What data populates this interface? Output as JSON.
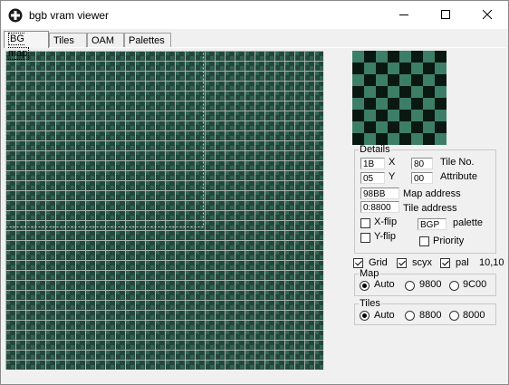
{
  "window": {
    "title": "bgb vram viewer"
  },
  "tabs": [
    {
      "label": "BG map",
      "active": true
    },
    {
      "label": "Tiles",
      "active": false
    },
    {
      "label": "OAM",
      "active": false
    },
    {
      "label": "Palettes",
      "active": false
    }
  ],
  "colors": {
    "tile_dark": "#24463c",
    "tile_light": "#3d7e68",
    "grid_line": "#a8b5ad",
    "selection": "#c8c8c8",
    "tile_black": "#0a1812"
  },
  "details": {
    "legend": "Details",
    "x_value": "1B",
    "x_label": "X",
    "y_value": "05",
    "y_label": "Y",
    "tile_no_value": "80",
    "tile_no_label": "Tile No.",
    "attribute_value": "00",
    "attribute_label": "Attribute",
    "map_address_value": "98BB",
    "map_address_label": "Map address",
    "tile_address_value": "0:8800",
    "tile_address_label": "Tile address",
    "xflip_label": "X-flip",
    "xflip_checked": false,
    "yflip_label": "Y-flip",
    "yflip_checked": false,
    "palette_value": "BGP",
    "palette_label": "palette",
    "priority_label": "Priority",
    "priority_checked": false
  },
  "options": {
    "grid_label": "Grid",
    "grid_checked": true,
    "scyx_label": "scyx",
    "scyx_checked": true,
    "pal_label": "pal",
    "pal_checked": true,
    "coords": "10,10"
  },
  "map_group": {
    "legend": "Map",
    "options": [
      "Auto",
      "9800",
      "9C00"
    ],
    "selected": "Auto"
  },
  "tiles_group": {
    "legend": "Tiles",
    "options": [
      "Auto",
      "8800",
      "8000"
    ],
    "selected": "Auto"
  }
}
